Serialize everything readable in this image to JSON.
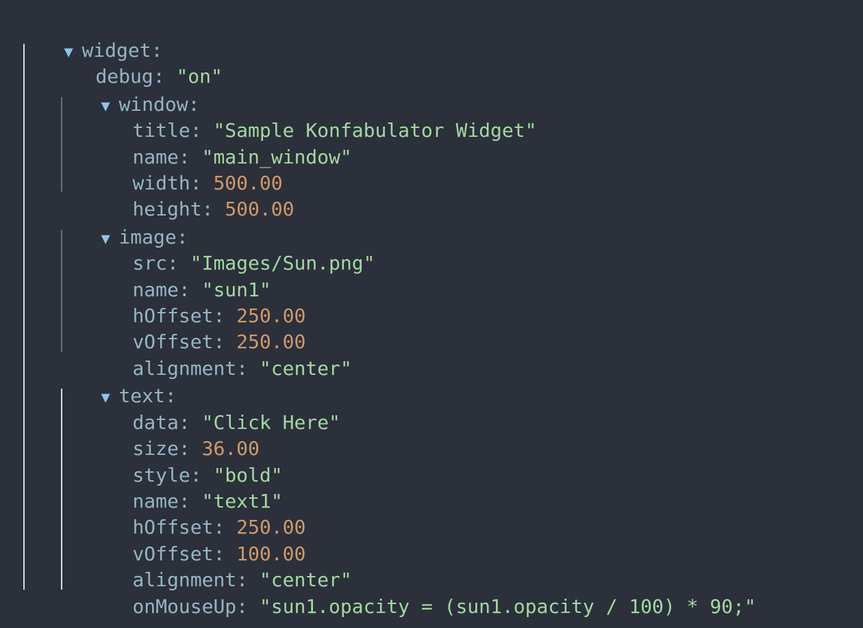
{
  "root": {
    "key": "widget",
    "toggle": "▼",
    "debug": {
      "key": "debug",
      "value": "\"on\""
    },
    "window": {
      "key": "window",
      "toggle": "▼",
      "title": {
        "key": "title",
        "value": "\"Sample Konfabulator Widget\""
      },
      "name": {
        "key": "name",
        "value": "\"main_window\""
      },
      "width": {
        "key": "width",
        "value": "500.00"
      },
      "height": {
        "key": "height",
        "value": "500.00"
      }
    },
    "image": {
      "key": "image",
      "toggle": "▼",
      "src": {
        "key": "src",
        "value": "\"Images/Sun.png\""
      },
      "name": {
        "key": "name",
        "value": "\"sun1\""
      },
      "hOffset": {
        "key": "hOffset",
        "value": "250.00"
      },
      "vOffset": {
        "key": "vOffset",
        "value": "250.00"
      },
      "alignment": {
        "key": "alignment",
        "value": "\"center\""
      }
    },
    "text": {
      "key": "text",
      "toggle": "▼",
      "data": {
        "key": "data",
        "value": "\"Click Here\""
      },
      "size": {
        "key": "size",
        "value": "36.00"
      },
      "style": {
        "key": "style",
        "value": "\"bold\""
      },
      "name": {
        "key": "name",
        "value": "\"text1\""
      },
      "hOffset": {
        "key": "hOffset",
        "value": "250.00"
      },
      "vOffset": {
        "key": "vOffset",
        "value": "100.00"
      },
      "alignment": {
        "key": "alignment",
        "value": "\"center\""
      },
      "onMouseUp": {
        "key": "onMouseUp",
        "value": "\"sun1.opacity = (sun1.opacity / 100) * 90;\""
      }
    }
  },
  "colors": {
    "background": "#2b303b",
    "key": "#96b5c4",
    "string": "#a3d9a0",
    "number": "#d09a6a",
    "toggle": "#8cc3e8"
  }
}
